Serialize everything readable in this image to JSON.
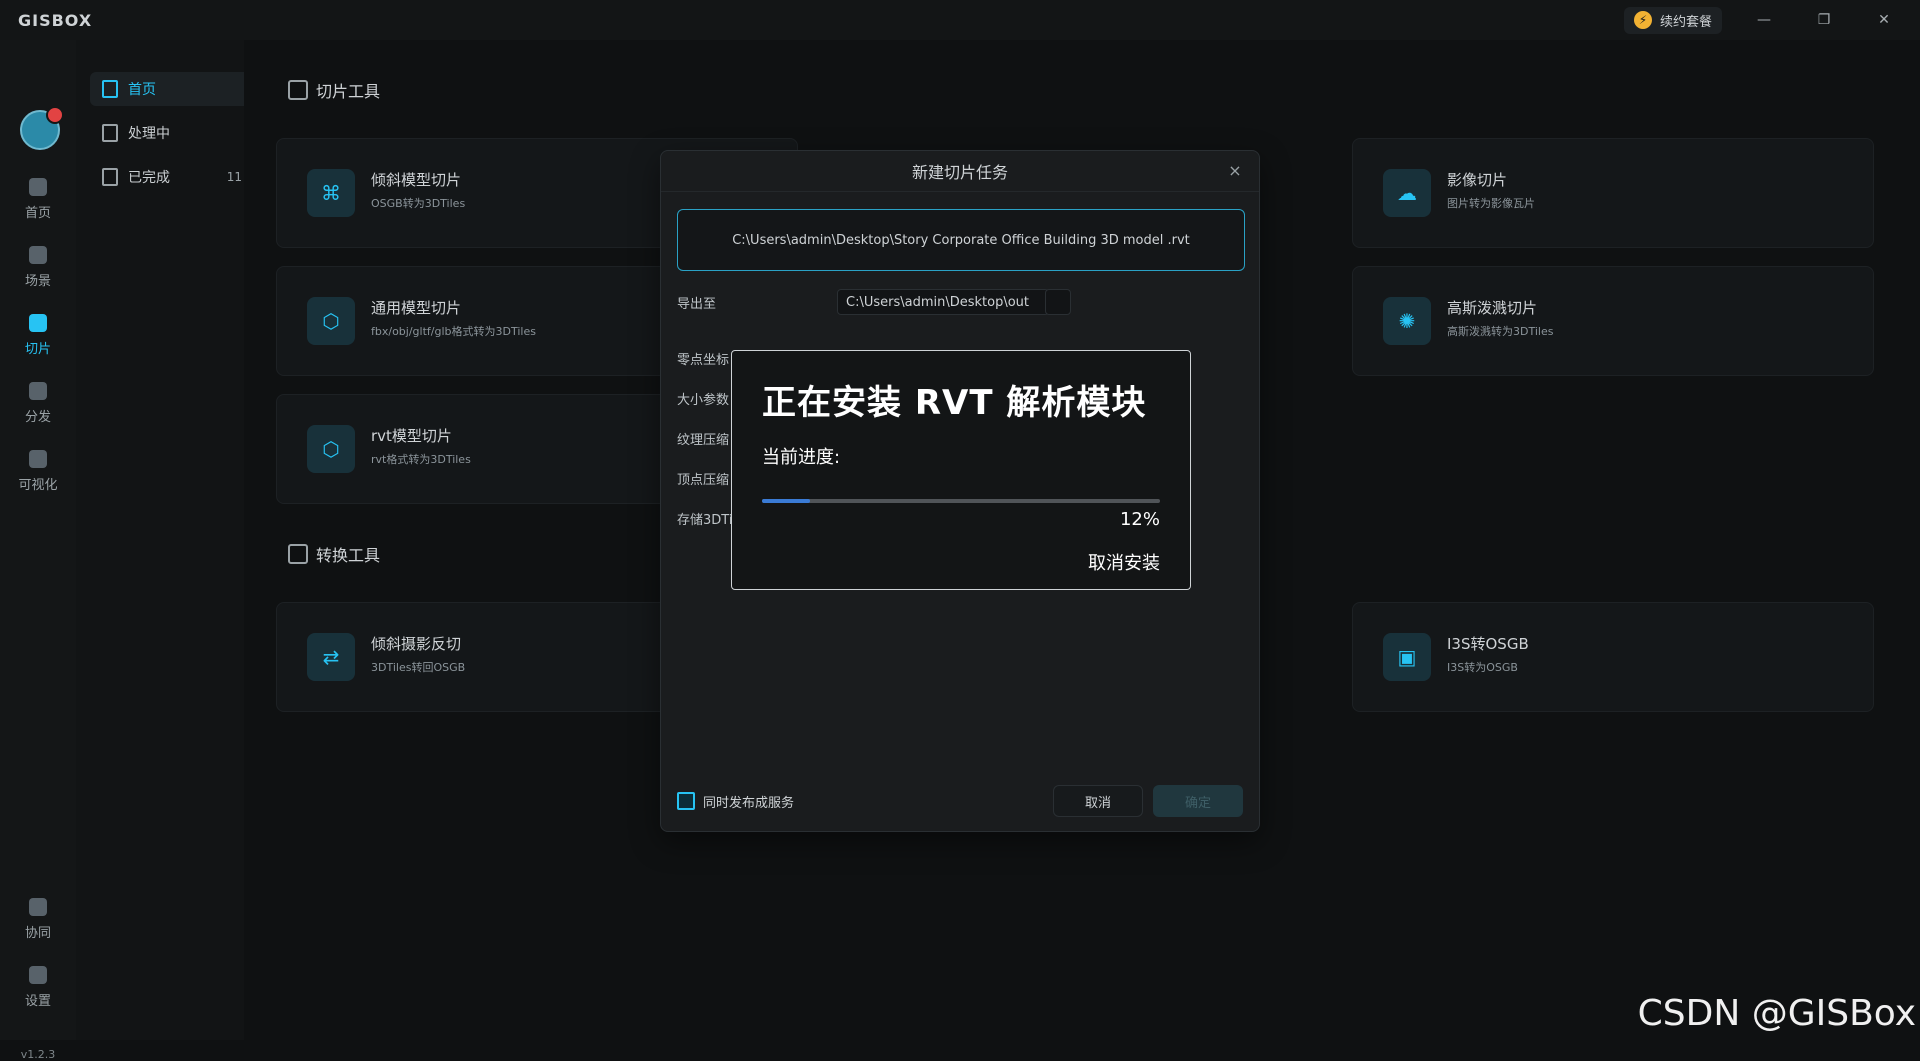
{
  "app": {
    "logo_text": "GISBOX",
    "renew_label": "续约套餐",
    "window_controls": [
      "minimize-icon",
      "restore-icon",
      "close-icon"
    ],
    "version": "v1.2.3",
    "colors": {
      "accent": "#27c3f3",
      "progress": "#3a7bd5"
    }
  },
  "sidebar": {
    "items": [
      {
        "label": "首页",
        "icon": "home-icon"
      },
      {
        "label": "场景",
        "icon": "scene-icon"
      },
      {
        "label": "切片",
        "icon": "slice-icon",
        "active": true
      },
      {
        "label": "分发",
        "icon": "distribute-icon"
      },
      {
        "label": "可视化",
        "icon": "visual-icon"
      },
      {
        "label": "协同",
        "icon": "team-icon"
      },
      {
        "label": "设置",
        "icon": "settings-icon"
      }
    ]
  },
  "subnav": {
    "items": [
      {
        "label": "首页",
        "active": true
      },
      {
        "label": "处理中"
      },
      {
        "label": "已完成",
        "count": "11"
      }
    ]
  },
  "main": {
    "slice_section_title": "切片工具",
    "convert_section_title": "转换工具",
    "cards": [
      {
        "title": "倾斜模型切片",
        "sub": "OSGB转为3DTiles"
      },
      {
        "title": "影像切片",
        "sub": "图片转为影像瓦片"
      },
      {
        "title": "通用模型切片",
        "sub": "fbx/obj/gltf/glb格式转为3DTiles"
      },
      {
        "title": "高斯泼溅切片",
        "sub": "高斯泼溅转为3DTiles"
      },
      {
        "title": "rvt模型切片",
        "sub": "rvt格式转为3DTiles"
      },
      {
        "title": "倾斜摄影反切",
        "sub": "3DTiles转回OSGB"
      },
      {
        "title": "I3S转OSGB",
        "sub": "I3S转为OSGB"
      }
    ]
  },
  "modal": {
    "title": "新建切片任务",
    "file_path": "C:\\Users\\admin\\Desktop\\Story Corporate Office Building 3D model .rvt",
    "export_label": "导出至",
    "export_path": "C:\\Users\\admin\\Desktop\\out",
    "rows": [
      "零点坐标",
      "大小参数",
      "纹理压缩",
      "顶点压缩",
      "存储3DTiles"
    ],
    "publish_checkbox_label": "同时发布成服务",
    "cancel_label": "取消",
    "confirm_label": "确定"
  },
  "install_dialog": {
    "title": "正在安装 RVT 解析模块",
    "progress_label": "当前进度:",
    "progress_value": 0.12,
    "progress_text": "12%",
    "cancel_text": "取消安装"
  },
  "watermark": "CSDN @GISBox"
}
